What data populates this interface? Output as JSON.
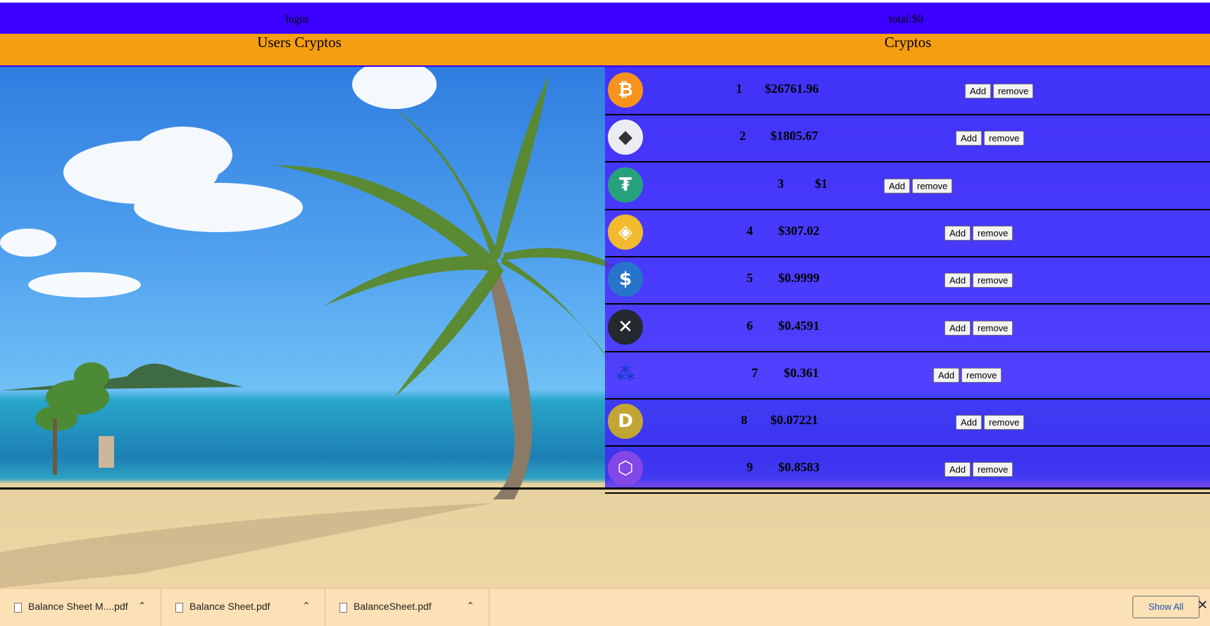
{
  "topbar": {
    "login": "login",
    "total": "total:$0"
  },
  "header": {
    "left_title": "Users Cryptos",
    "right_title": "Cryptos"
  },
  "cryptos": [
    {
      "rank": "1",
      "price": "$26761.96",
      "icon": "bitcoin-icon"
    },
    {
      "rank": "2",
      "price": "$1805.67",
      "icon": "ethereum-icon"
    },
    {
      "rank": "3",
      "price": "$1",
      "icon": "tether-icon"
    },
    {
      "rank": "4",
      "price": "$307.02",
      "icon": "bnb-icon"
    },
    {
      "rank": "5",
      "price": "$0.9999",
      "icon": "usdc-icon"
    },
    {
      "rank": "6",
      "price": "$0.4591",
      "icon": "xrp-icon"
    },
    {
      "rank": "7",
      "price": "$0.361",
      "icon": "cardano-icon"
    },
    {
      "rank": "8",
      "price": "$0.07221",
      "icon": "dogecoin-icon"
    },
    {
      "rank": "9",
      "price": "$0.8583",
      "icon": "polygon-icon"
    }
  ],
  "buttons": {
    "add": "Add",
    "remove": "remove"
  },
  "downloads": [
    {
      "name": "Balance Sheet M....pdf"
    },
    {
      "name": "Balance Sheet.pdf"
    },
    {
      "name": "BalanceSheet.pdf"
    }
  ],
  "shelf": {
    "show_all": "Show All",
    "close": "✕"
  },
  "colors": {
    "topbar": "#3c00ff",
    "header": "#f59e12",
    "panel": "#4a1eff",
    "shelf": "#fde1b6"
  }
}
